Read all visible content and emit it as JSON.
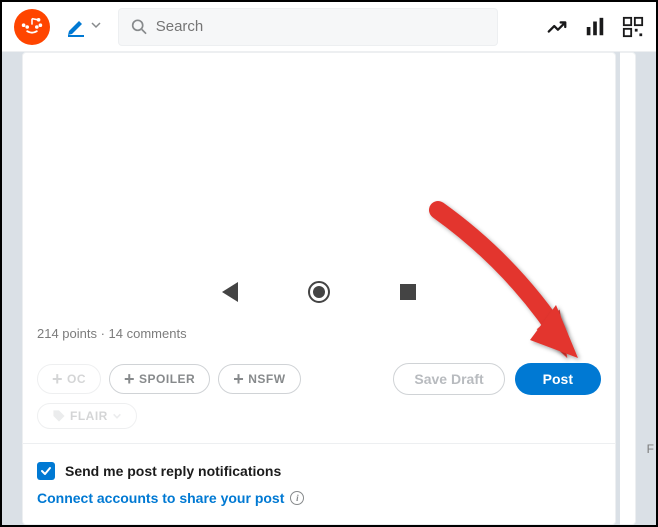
{
  "header": {
    "search_placeholder": "Search"
  },
  "preview": {
    "stats": "214 points · 14 comments"
  },
  "tags": {
    "oc": "OC",
    "spoiler": "SPOILER",
    "nsfw": "NSFW",
    "flair": "FLAIR"
  },
  "actions": {
    "save_draft": "Save Draft",
    "post": "Post"
  },
  "notifications": {
    "reply_label": "Send me post reply notifications",
    "connect_label": "Connect accounts to share your post"
  }
}
